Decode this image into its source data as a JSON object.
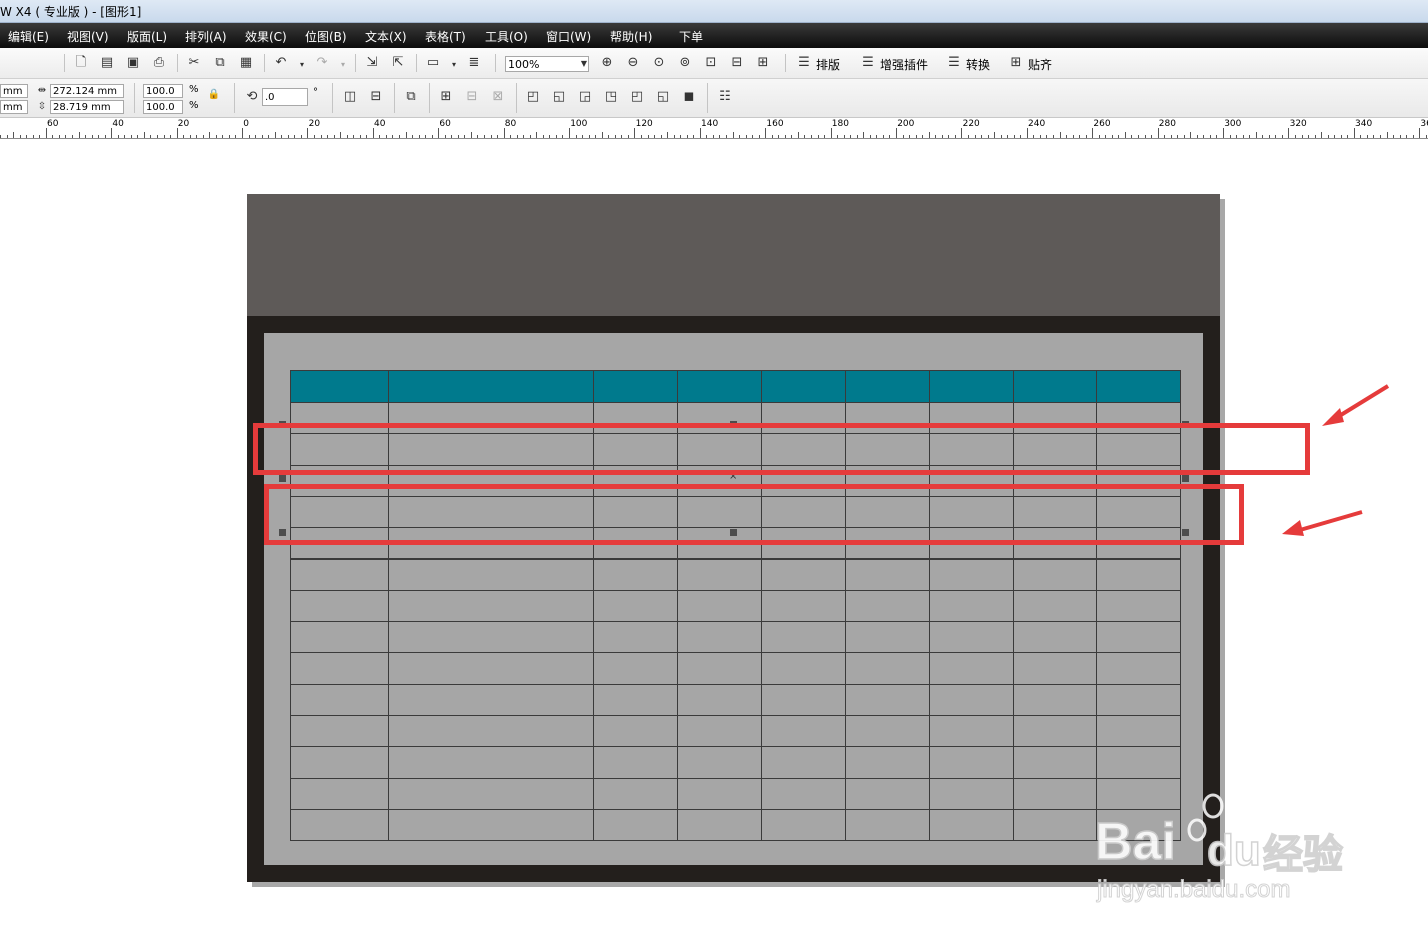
{
  "title": "W X4 ( 专业版 ) - [图形1]",
  "menu": [
    "编辑(E)",
    "视图(V)",
    "版面(L)",
    "排列(A)",
    "效果(C)",
    "位图(B)",
    "文本(X)",
    "表格(T)",
    "工具(O)",
    "窗口(W)",
    "帮助(H)",
    "下单"
  ],
  "toolbar1": {
    "zoom_value": "100%",
    "buttons": [
      {
        "name": "new-icon",
        "glyph": "🗋"
      },
      {
        "name": "open-icon",
        "glyph": "📂"
      },
      {
        "name": "save-icon",
        "glyph": "💾"
      },
      {
        "name": "print-icon",
        "glyph": "🖶"
      },
      {
        "name": "cut-icon",
        "glyph": "✂"
      },
      {
        "name": "copy-icon",
        "glyph": "⧉"
      },
      {
        "name": "paste-icon",
        "glyph": "📋"
      },
      {
        "name": "undo-icon",
        "glyph": "↶"
      },
      {
        "name": "redo-icon",
        "glyph": "↷"
      },
      {
        "name": "import-icon",
        "glyph": "⇲"
      },
      {
        "name": "export-icon",
        "glyph": "⇱"
      },
      {
        "name": "application-launcher-icon",
        "glyph": "▭"
      },
      {
        "name": "spell-check-icon",
        "glyph": "≣"
      }
    ],
    "zoom_tools": [
      "zoom-in-icon",
      "zoom-out-icon",
      "zoom-selected-icon",
      "zoom-all-icon",
      "zoom-page-icon",
      "zoom-width-icon",
      "zoom-height-icon"
    ],
    "plugins": [
      "排版",
      "增强插件",
      "转换",
      "贴齐"
    ]
  },
  "toolbar2": {
    "x_unit": "mm",
    "y_unit": "mm",
    "width": "272.124 mm",
    "height": "28.719 mm",
    "scale_x": "100.0",
    "scale_y": "100.0",
    "percent": "%",
    "rotation": ".0",
    "degree": "°"
  },
  "ruler": {
    "labels": [
      "60",
      "40",
      "20",
      "0",
      "20",
      "40",
      "60",
      "80",
      "100",
      "120",
      "140",
      "160",
      "180",
      "200",
      "220",
      "240",
      "260",
      "280",
      "300",
      "320",
      "340",
      "36"
    ]
  },
  "table": {
    "columns": 9,
    "rows": 15,
    "header_color": "#007a8d",
    "body_color": "#a6a6a6"
  },
  "colors": {
    "page_frame": "#231f1c",
    "header_band": "#5e5a58",
    "callout": "#e53b3b"
  },
  "watermark": {
    "brand": "Bai",
    "brand_cn": "经验",
    "url": "jingyan.baidu.com"
  }
}
